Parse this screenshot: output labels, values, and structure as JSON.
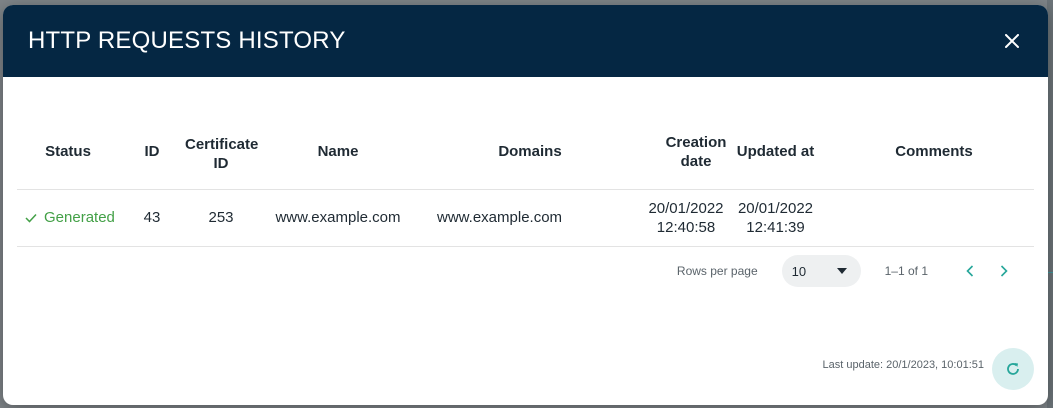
{
  "dialog": {
    "title": "HTTP REQUESTS HISTORY",
    "close_icon": "close-icon"
  },
  "table": {
    "columns": [
      {
        "key": "status",
        "label": "Status"
      },
      {
        "key": "id",
        "label": "ID"
      },
      {
        "key": "certificate_id",
        "label": "Certificate ID"
      },
      {
        "key": "name",
        "label": "Name"
      },
      {
        "key": "domains",
        "label": "Domains"
      },
      {
        "key": "creation_date",
        "label": "Creation date"
      },
      {
        "key": "updated_at",
        "label": "Updated at"
      },
      {
        "key": "comments",
        "label": "Comments"
      }
    ],
    "rows": [
      {
        "status": "Generated",
        "status_icon": "check-icon",
        "id": "43",
        "certificate_id": "253",
        "name": "www.example.com",
        "domains": "www.example.com",
        "creation_date": "20/01/2022",
        "creation_time": "12:40:58",
        "updated_date": "20/01/2022",
        "updated_time": "12:41:39",
        "comments": ""
      }
    ]
  },
  "pagination": {
    "rows_per_page_label": "Rows per page",
    "rows_per_page_value": "10",
    "range": "1–1 of 1"
  },
  "footer": {
    "last_update": "Last update: 20/1/2023, 10:01:51"
  },
  "colors": {
    "header_bg": "#052743",
    "status_success": "#43a047",
    "accent": "#26a69a",
    "refresh_bg": "#d9efef"
  }
}
